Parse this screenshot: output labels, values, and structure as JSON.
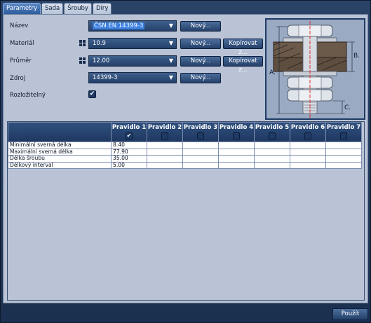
{
  "tabs": [
    {
      "label": "Parametry",
      "active": true
    },
    {
      "label": "Sada",
      "active": false
    },
    {
      "label": "Šrouby",
      "active": false
    },
    {
      "label": "Díry",
      "active": false
    }
  ],
  "form": {
    "nazev": {
      "label": "Název",
      "value": "ČSN EN 14399-3",
      "new_label": "Nový..."
    },
    "material": {
      "label": "Materiál",
      "value": "10.9",
      "new_label": "Nový...",
      "copy_label": "Kopírovat z..."
    },
    "prumer": {
      "label": "Průměr",
      "value": "12.00",
      "new_label": "Nový...",
      "copy_label": "Kopírovat z..."
    },
    "zdroj": {
      "label": "Zdroj",
      "value": "14399-3",
      "new_label": "Nový..."
    },
    "rozlozitelny": {
      "label": "Rozložitelný",
      "checked": true,
      "check_glyph": "✔"
    }
  },
  "diagram": {
    "labels": {
      "a": "A.",
      "b": "B.",
      "c": "C."
    }
  },
  "table": {
    "columns": [
      "Pravidlo 1",
      "Pravidlo 2",
      "Pravidlo 3",
      "Pravidlo 4",
      "Pravidlo 5",
      "Pravidlo 6",
      "Pravidlo 7"
    ],
    "column_checked": [
      true,
      false,
      false,
      false,
      false,
      false,
      false
    ],
    "rows": [
      {
        "label": "Minimální sverná délka",
        "values": [
          "8.40",
          "",
          "",
          "",
          "",
          "",
          ""
        ]
      },
      {
        "label": "Maximální sverná délka",
        "values": [
          "77.90",
          "",
          "",
          "",
          "",
          "",
          ""
        ]
      },
      {
        "label": "Délka šroubu",
        "values": [
          "35.00",
          "",
          "",
          "",
          "",
          "",
          ""
        ]
      },
      {
        "label": "Délkový interval",
        "values": [
          "5.00",
          "",
          "",
          "",
          "",
          "",
          ""
        ]
      }
    ]
  },
  "apply_label": "Použít",
  "colors": {
    "accent": "#2d5c9c",
    "panel": "#b9c3d5",
    "frame": "#1b2f4f",
    "axis_line": "#e03030"
  }
}
